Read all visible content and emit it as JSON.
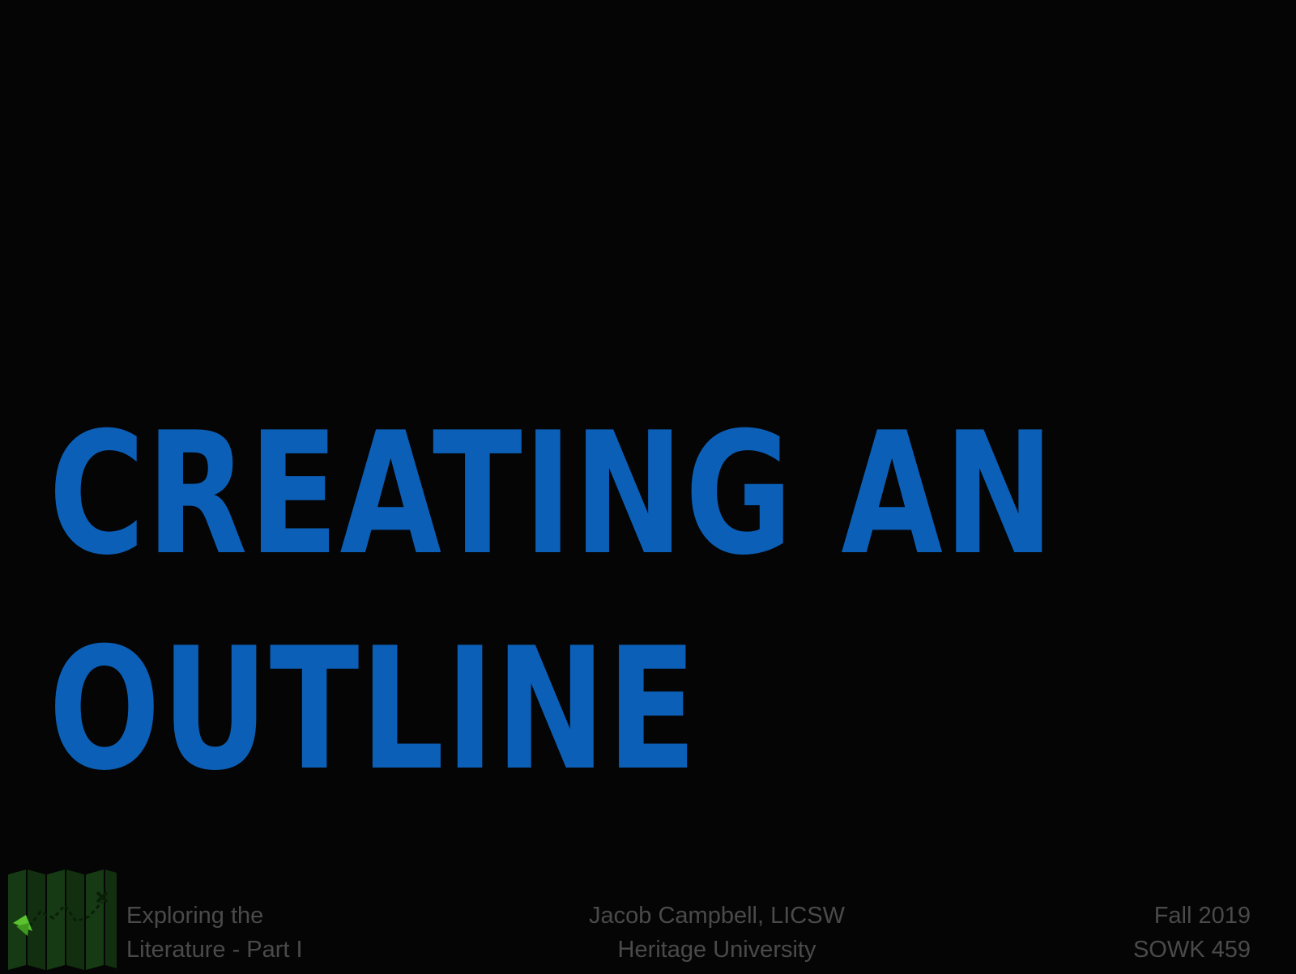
{
  "slide": {
    "title_line_1": "CREATING AN",
    "title_line_2": "OUTLINE"
  },
  "footer": {
    "left_line_1": "Exploring the",
    "left_line_2": "Literature - Part I",
    "center_line_1": "Jacob Campbell, LICSW",
    "center_line_2": "Heritage University",
    "right_line_1": "Fall 2019",
    "right_line_2": "SOWK 459"
  },
  "logo": {
    "icon": "treasure-map-icon"
  },
  "colors": {
    "background": "#050505",
    "title": "#0c5fb7",
    "footer_text": "#4a4a4a",
    "map_green": "#163a13",
    "map_accent": "#5bc12f"
  }
}
